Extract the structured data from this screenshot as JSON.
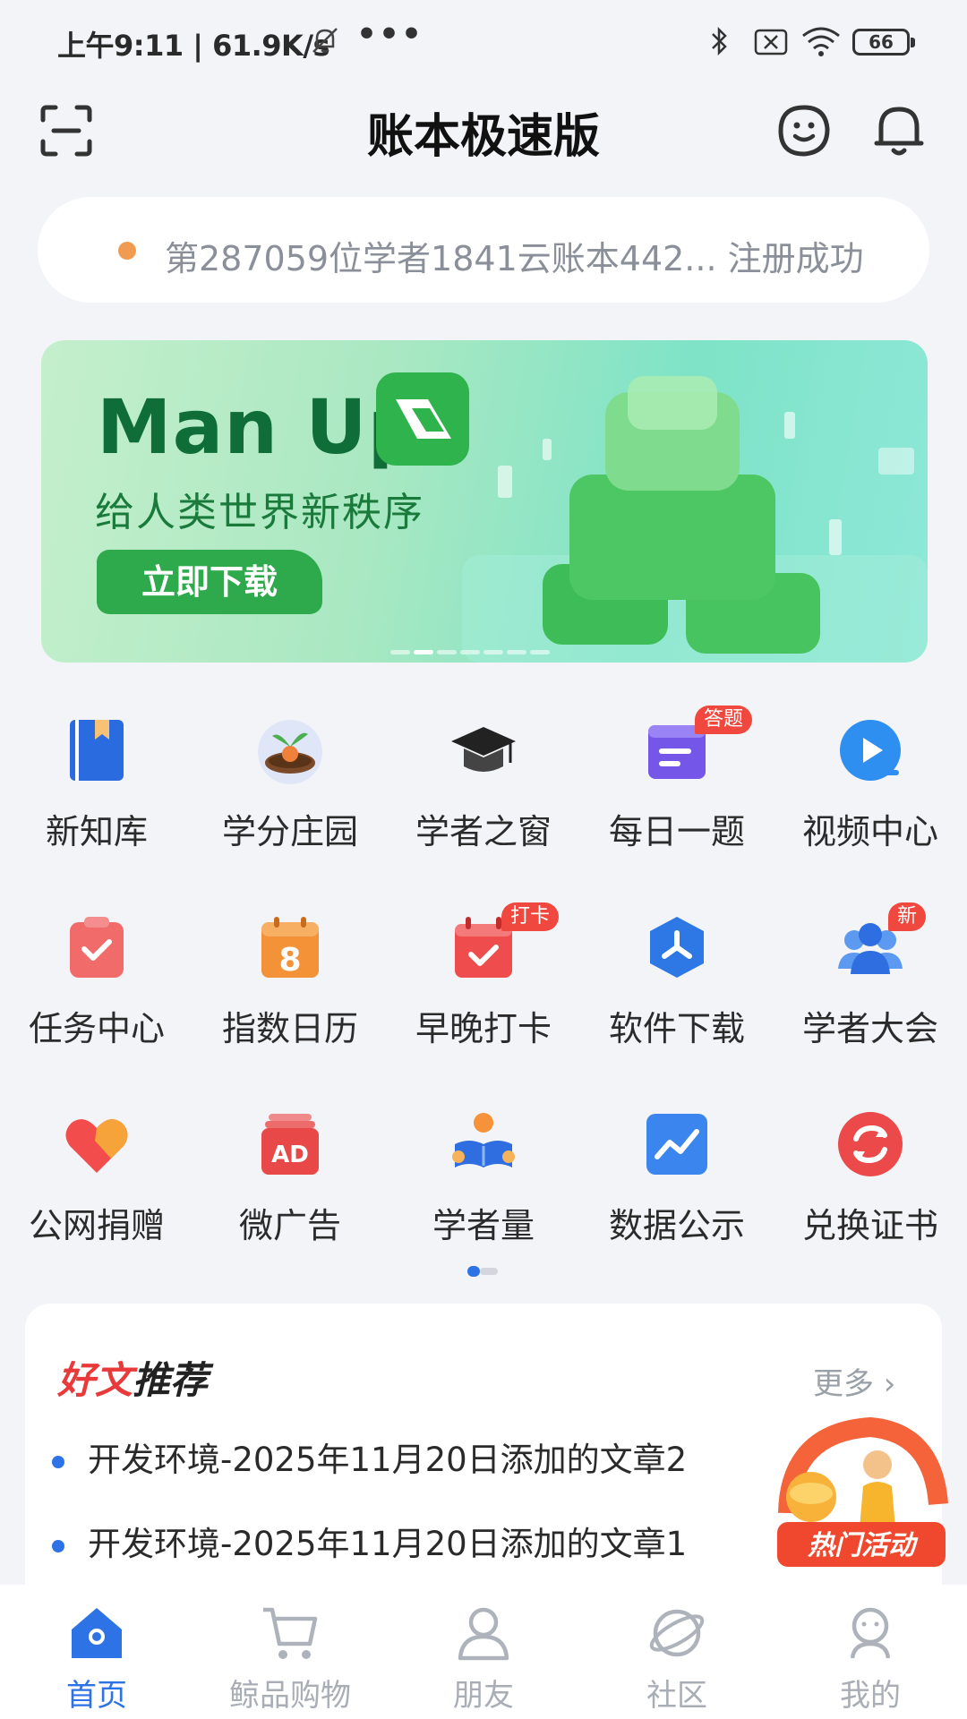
{
  "status_bar": {
    "time_speed": "上午9:11 | 61.9K/s",
    "more": "•••",
    "battery": "66"
  },
  "header": {
    "title": "账本极速版",
    "icons": [
      "scan-icon",
      "customer-service-icon",
      "bell-icon"
    ]
  },
  "notice": {
    "text": "第287059位学者1841云账本442...  注册成功"
  },
  "banner": {
    "headline": "Man Up",
    "subtitle": "给人类世界新秩序",
    "button": "立即下载",
    "colors": {
      "headline": "#0f6e37",
      "button": "#2ea94c"
    }
  },
  "grid": [
    {
      "label": "新知库",
      "icon": "book-icon",
      "badge": ""
    },
    {
      "label": "学分庄园",
      "icon": "sprout-pot-icon",
      "badge": ""
    },
    {
      "label": "学者之窗",
      "icon": "graduation-cap-icon",
      "badge": ""
    },
    {
      "label": "每日一题",
      "icon": "quiz-card-icon",
      "badge": "答题"
    },
    {
      "label": "视频中心",
      "icon": "video-play-icon",
      "badge": ""
    },
    {
      "label": "任务中心",
      "icon": "task-clipboard-icon",
      "badge": ""
    },
    {
      "label": "指数日历",
      "icon": "calendar-8-icon",
      "badge": ""
    },
    {
      "label": "早晚打卡",
      "icon": "checkin-calendar-icon",
      "badge": "打卡"
    },
    {
      "label": "软件下载",
      "icon": "software-hex-icon",
      "badge": ""
    },
    {
      "label": "学者大会",
      "icon": "people-group-icon",
      "badge": "新"
    },
    {
      "label": "公网捐赠",
      "icon": "heart-icon",
      "badge": ""
    },
    {
      "label": "微广告",
      "icon": "ad-icon",
      "badge": ""
    },
    {
      "label": "学者量",
      "icon": "reader-icon",
      "badge": ""
    },
    {
      "label": "数据公示",
      "icon": "trend-chart-icon",
      "badge": ""
    },
    {
      "label": "兑换证书",
      "icon": "exchange-icon",
      "badge": ""
    }
  ],
  "articles": {
    "title_red": "好文",
    "title_black": "推荐",
    "more": "更多 ›",
    "items": [
      "开发环境-2025年11月20日添加的文章2",
      "开发环境-2025年11月20日添加的文章1"
    ]
  },
  "hot_activity": {
    "label": "热门活动"
  },
  "tabbar": [
    {
      "label": "首页",
      "icon": "home-icon",
      "active": true
    },
    {
      "label": "鲸品购物",
      "icon": "cart-icon",
      "active": false
    },
    {
      "label": "朋友",
      "icon": "friend-icon",
      "active": false
    },
    {
      "label": "社区",
      "icon": "planet-icon",
      "active": false
    },
    {
      "label": "我的",
      "icon": "profile-icon",
      "active": false
    }
  ],
  "accent_color": "#2d73e6"
}
